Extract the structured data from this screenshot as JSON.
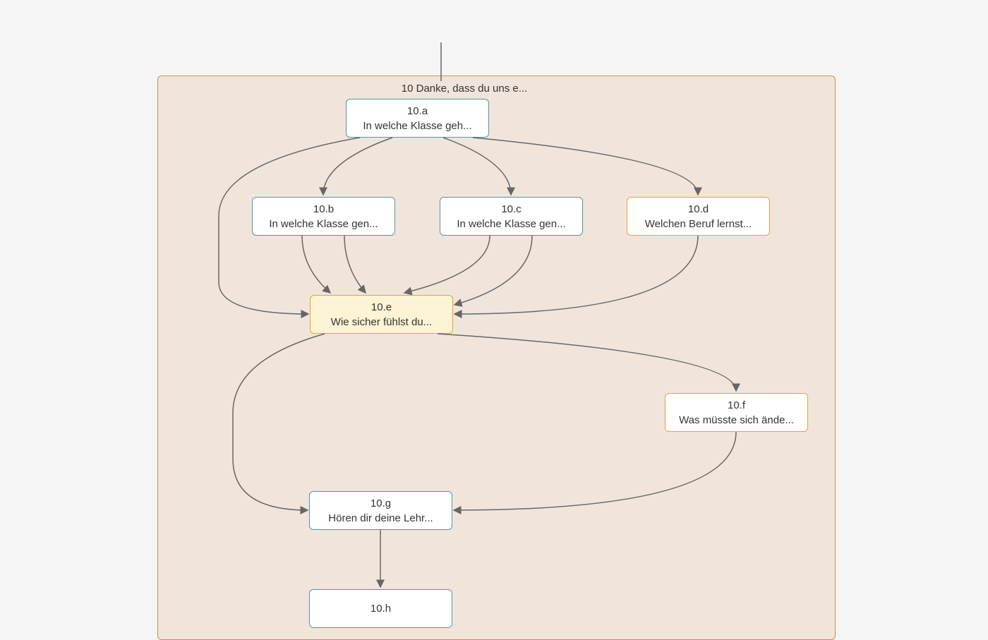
{
  "group": {
    "title": "10 Danke, dass du uns e..."
  },
  "nodes": {
    "a": {
      "id": "10.a",
      "label": "In welche Klasse geh..."
    },
    "b": {
      "id": "10.b",
      "label": "In welche Klasse gen..."
    },
    "c": {
      "id": "10.c",
      "label": "In welche Klasse gen..."
    },
    "d": {
      "id": "10.d",
      "label": "Welchen Beruf lernst..."
    },
    "e": {
      "id": "10.e",
      "label": "Wie sicher fühlst du..."
    },
    "f": {
      "id": "10.f",
      "label": "Was müsste sich ände..."
    },
    "g": {
      "id": "10.g",
      "label": "Hören dir deine Lehr..."
    },
    "h": {
      "id": "10.h",
      "label": ""
    }
  },
  "colors": {
    "teal": "#4a9b9b",
    "orange": "#e6a23c",
    "yellow_border": "#d4b020",
    "yellow_fill": "#fdf3d5",
    "frame_border": "#d68c3e",
    "frame_fill": "#f1e5db",
    "arrow": "#666666"
  }
}
